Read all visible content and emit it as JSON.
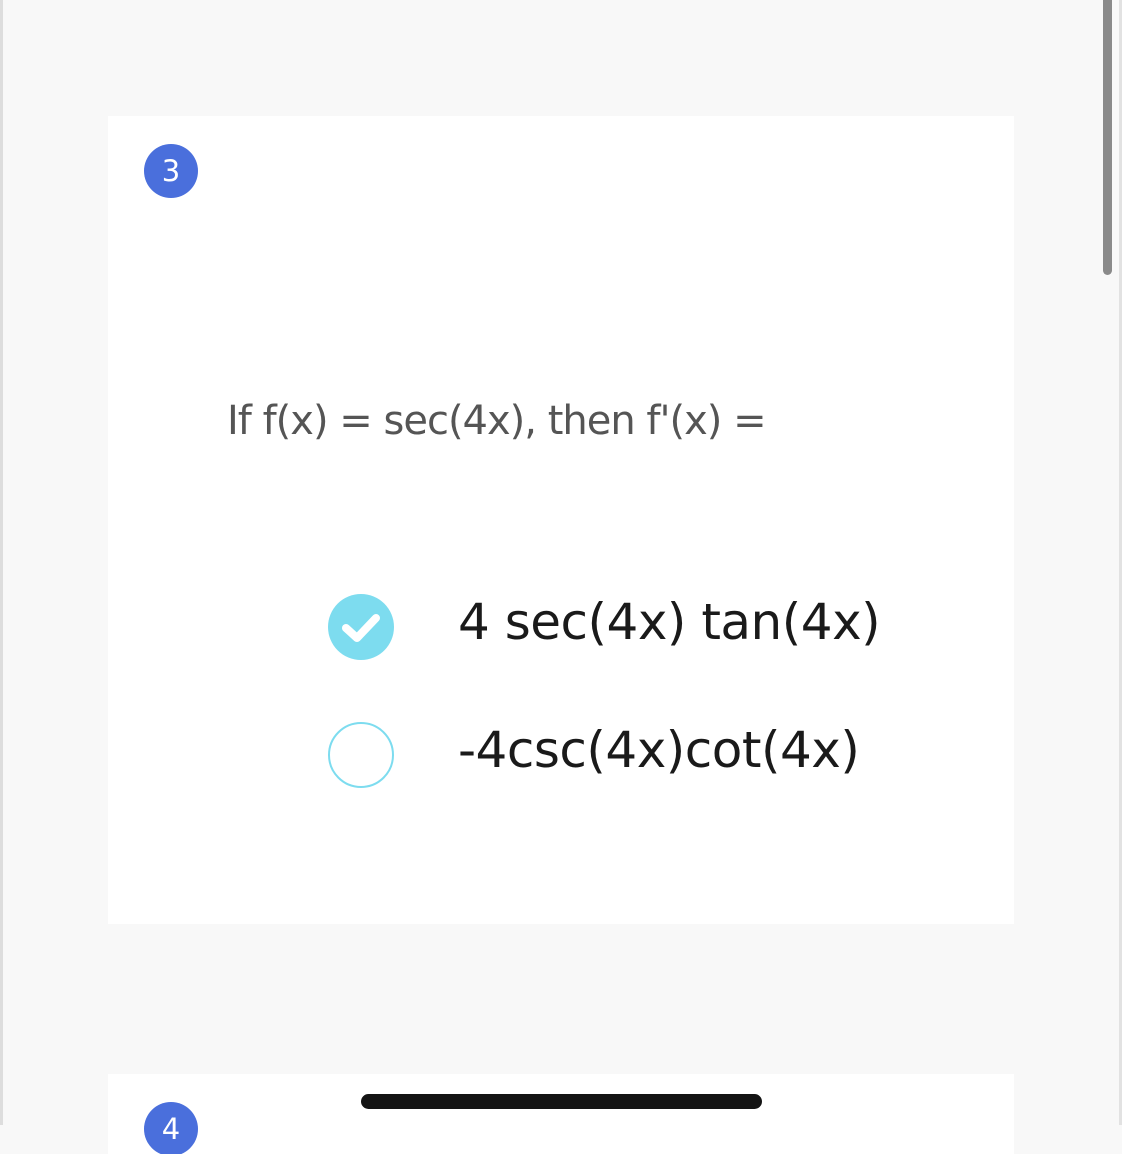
{
  "question": {
    "number": "3",
    "text": "If f(x) = sec(4x), then f'(x) =",
    "options": [
      {
        "label": "4 sec(4x) tan(4x)",
        "selected": true
      },
      {
        "label": "-4csc(4x)cot(4x)",
        "selected": false
      }
    ]
  },
  "next_question": {
    "number": "4"
  },
  "colors": {
    "badge": "#4a6fdc",
    "radio_accent": "#7ddcef",
    "page_background": "#f8f8f8",
    "card_background": "#ffffff"
  },
  "icons": {
    "selected": "checkmark-icon"
  }
}
